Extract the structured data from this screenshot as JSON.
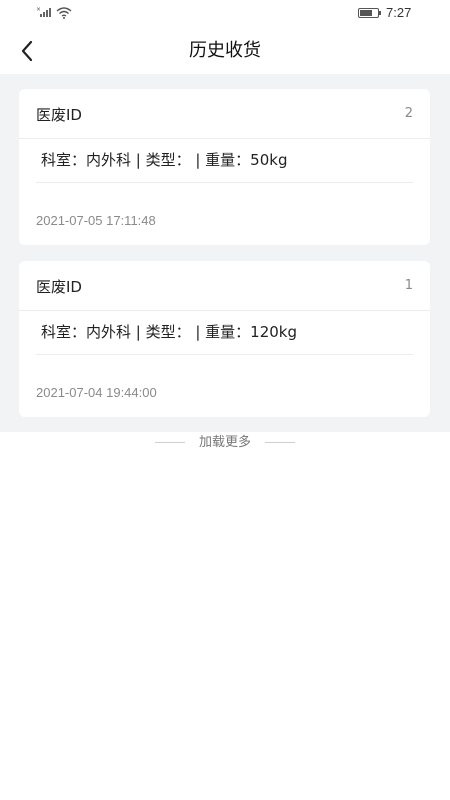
{
  "status_bar": {
    "time": "7:27"
  },
  "header": {
    "title": "历史收货"
  },
  "records": [
    {
      "title": "医废ID",
      "index": "2",
      "info": "科室：内外科 | 类型：  | 重量：50kg",
      "timestamp": "2021-07-05 17:11:48"
    },
    {
      "title": "医废ID",
      "index": "1",
      "info": "科室：内外科 | 类型：  | 重量：120kg",
      "timestamp": "2021-07-04 19:44:00"
    }
  ],
  "footer": {
    "load_more": "加载更多"
  },
  "icons": {
    "back": "chevron-left-icon",
    "signal": "signal-icon",
    "wifi": "wifi-icon",
    "battery": "battery-icon"
  }
}
